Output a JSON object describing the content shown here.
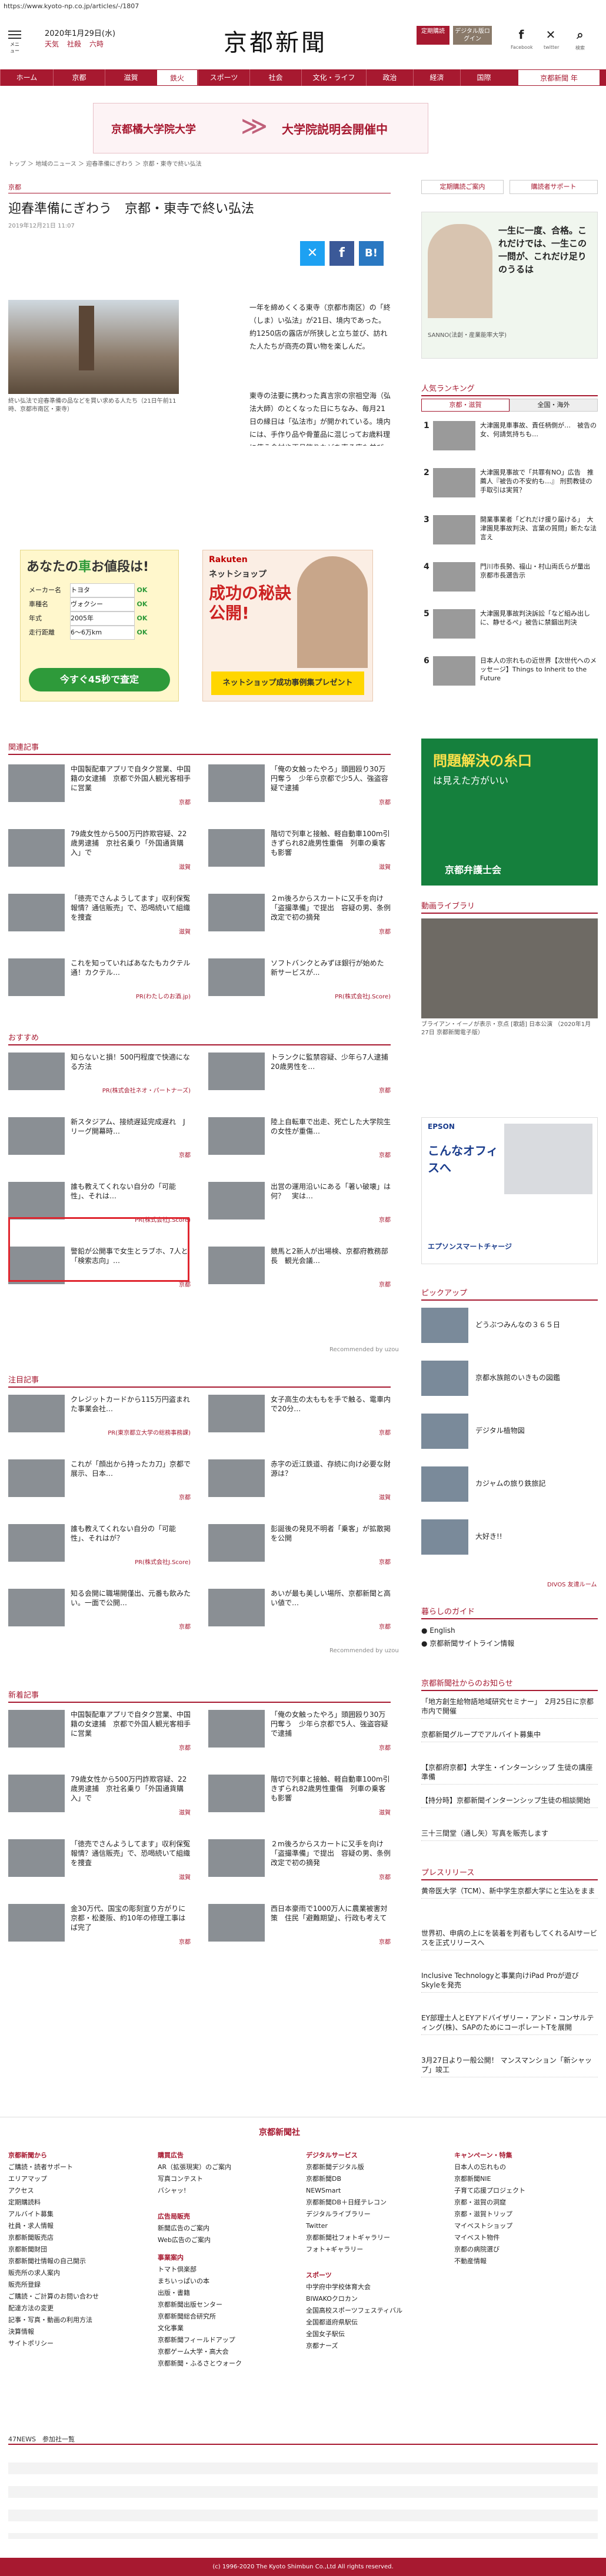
{
  "url": "https://www.kyoto-np.co.jp/articles/-/1807",
  "header": {
    "menu_label": "メニュー",
    "date": "2020年1月29日(水)",
    "weather": [
      "天気",
      "社殺",
      "六時"
    ],
    "logo": "京都新聞",
    "btn1": "定期購読",
    "btn2": "デジタル版ログイン",
    "social": [
      "Facebook",
      "twitter",
      "検索"
    ]
  },
  "nav": [
    "ホーム",
    "京都",
    "滋賀",
    "鉄火",
    "スポーツ",
    "社会",
    "文化・ライフ",
    "政治",
    "経済",
    "国際",
    "京都新聞 年"
  ],
  "ad_banner": {
    "left": "京都橘大学院大学",
    "right": "大学院説明会開催中"
  },
  "breadcrumb": "トップ ＞ 地域のニュース ＞ 迎春準備にぎわう ＞ 京都・東寺で終い弘法",
  "article": {
    "category": "京都",
    "title": "迎春準備にぎわう　京都・東寺で終い弘法",
    "date": "2019年12月21日 11:07",
    "caption": "終い弘法で迎春準備の品などを買い求める人たち（21日午前11時、京都市南区・東寺）",
    "body1": "一年を締めくくる東寺（京都市南区）の「終（しま）い弘法」が21日、境内であった。約1250店の露店が所狭しと立ち並び、訪れた人たちが商売の買い物を楽しんだ。",
    "body2": "東寺の法要に携わった真言宗の宗祖空海（弘法大師）のとくなった日にちなみ、毎月21日の縁日は「弘法市」が開かれている。境内には、手作り品や骨董品に混じってお歳料理に使う食材や正月飾りなどを売る店も並び、訪れた人たちが足を止めて品定めする姿が見られた。境内南側の弘法大師（修行大師）像の前では参拝者が後を絶たず、迎春の雰囲気が一層に広がった。"
  },
  "car_ad": {
    "title": "あなたの",
    "car": "車",
    "sub": "お値段は!",
    "rows": [
      [
        "メーカー名",
        "トヨタ",
        "OK"
      ],
      [
        "車種名",
        "ヴォクシー",
        "OK"
      ],
      [
        "年式",
        "2005年",
        "OK"
      ],
      [
        "走行距離",
        "6〜6万km",
        "OK"
      ]
    ],
    "cta": "今すぐ45秒で査定"
  },
  "rakuten_ad": {
    "brand": "Rakuten",
    "title": "ネットショップ",
    "big": "成功の秘訣公開!",
    "sub": "ネットショップ成功事例集プレゼント"
  },
  "related": {
    "title": "関連記事",
    "items": [
      {
        "t": "中国製配車アプリで自タク営業、中国籍の女逮捕　京都で外国人観光客相手に営業",
        "s": "京都"
      },
      {
        "t": "「俺の女触ったやろ」頭囲殴り30万円奪う　少年ら京都で少5人、強盗容疑で逮捕",
        "s": "京都"
      },
      {
        "t": "79歳女性から500万円詐欺容疑、22歳男逮捕　京社名乗り「外国通貨購入」で",
        "s": "滋賀"
      },
      {
        "t": "階切で列車と接触、軽自動車100m引きずられ82歳男性重傷　列車の乗客も影響",
        "s": "滋賀"
      },
      {
        "t": "「徳売でさんようしてます」収利保冤報情？通信販売」で、恐喝続いて組織を捜査",
        "s": "滋賀"
      },
      {
        "t": "２m後ろからスカートに又手を向け「盗撮準備」で提出　容疑の男、条例改定で初の摘発",
        "s": "京都"
      },
      {
        "t": "これを知っていればあなたもカクテル通！カクテル…",
        "s": "PR(わたしのお酒.jp)"
      },
      {
        "t": "ソフトバンクとみずほ銀行が始めた新サービスが...",
        "s": "PR(株式会社J.Score)"
      }
    ]
  },
  "osusume": {
    "title": "おすすめ",
    "items": [
      {
        "t": "知らないと損！500円程度で快適になる方法",
        "s": "PR(株式会社ネオ・パートナーズ)"
      },
      {
        "t": "トランクに監禁容疑、少年ら7人逮捕　20歳男性を…",
        "s": "京都"
      },
      {
        "t": "新スタジアム、接続遅延完成遅れ　Jリーグ開幕時…",
        "s": "京都"
      },
      {
        "t": "陸上自転車で出走、死亡した大学院生の女性が重傷…",
        "s": "京都"
      },
      {
        "t": "誰も教えてくれない自分の「可能性」、それは…",
        "s": "PR(株式会社J.Score)"
      },
      {
        "t": "出営の運用沿いにある「著い破壊」は何？　実は…",
        "s": "京都"
      },
      {
        "t": "警鉛が公開事で女生とラブホ、7人と「検索志向」…",
        "s": "京都"
      },
      {
        "t": "競馬と2新人が出場検、京都府教務部長　観光会議…",
        "s": "京都"
      }
    ],
    "rec": "Recommended by uzou"
  },
  "notice": {
    "title": "注目記事",
    "items": [
      {
        "t": "クレジットカードから115万円盗まれた事業会社…",
        "s": "PR(東京都立大学の総務事務課)"
      },
      {
        "t": "女子高生の太ももを手で触る、電車内で20分…",
        "s": "京都"
      },
      {
        "t": "これが「顔出から持ったカ刀」京都で展示、日本…",
        "s": "京都"
      },
      {
        "t": "赤字の近江鉄道、存続に向け必要な財源は？",
        "s": "滋賀"
      },
      {
        "t": "誰も教えてくれない自分の「可能性」、それはが？",
        "s": "PR(株式会社J.Score)"
      },
      {
        "t": "彭誕後の発見不明者「乗客」が拡散掲を公開",
        "s": "京都"
      },
      {
        "t": "知る会開に職場開僅出、元番も飲みたい。一面で公開…",
        "s": "京都"
      },
      {
        "t": "あいが最も美しい場所、京都新聞と高い値で…",
        "s": "京都"
      }
    ],
    "rec": "Recommended by uzou"
  },
  "new": {
    "title": "新着記事",
    "items": [
      {
        "t": "中国製配車アプリで自タク営業、中国籍の女逮捕　京都で外国人観光客相手に営業",
        "s": "京都"
      },
      {
        "t": "「俺の女触ったやろ」頭囲殴り30万円奪う　少年ら京都で5人、強盗容疑で逮捕",
        "s": "京都"
      },
      {
        "t": "79歳女性から500万円詐欺容疑、22歳男逮捕　京社名乗り「外国通貨購入」で",
        "s": "滋賀"
      },
      {
        "t": "階切で列車と接触、軽自動車100m引きずられ82歳男性重傷　列車の乗客も影響",
        "s": "滋賀"
      },
      {
        "t": "「徳売でさんようしてます」収利保冤報情？通信販売」で、恐喝続いて組織を捜査",
        "s": "滋賀"
      },
      {
        "t": "２m後ろからスカートに又手を向け「盗撮準備」で提出　容疑の男、条例改定で初の摘発",
        "s": "京都"
      },
      {
        "t": "金30万代、国宝の彫刻宣り方がりに　京都・松菱阪、約10年の修理工事はば完了",
        "s": "京都"
      },
      {
        "t": "西日本豪雨で1000万人に農業被害対策　住民「避難期望」、行政も考えて",
        "s": "京都"
      }
    ]
  },
  "side": {
    "links": [
      "定期購読ご案内",
      "購読者サポート"
    ],
    "ad1": {
      "t": "一生に一度、合格。これだけでは、一生この一問が、これだけ足りのうるは",
      "sub": "SANNO(法創・産業能率大学)"
    },
    "rank_title": "人気ランキング",
    "rank_tabs": [
      "京都・滋賀",
      "全国・海外"
    ],
    "ranks": [
      {
        "n": "1",
        "t": "大津園見車事故、責任柄側が…　被告の女、何請気持ちも…"
      },
      {
        "t": "大津園見事故で「共罪有NO」広告　推薦人『被告の不安約も…』 刑罰教徒の手取引は実質？",
        "n": "2"
      },
      {
        "t": "開業事業者「どれだけ援り届ける」　大津園見事故判決、言葉の質問」新たな法言え",
        "n": "3"
      },
      {
        "t": "門川市長勢、福山・村山両氏らが量出　京都市長選告示",
        "n": "4"
      },
      {
        "t": "大津園見事故判決訴訟「など組み出しに、静せるぺ」被告に禁錮出判決",
        "n": "5"
      },
      {
        "t": "日本人の宗れもの近世界【次世代へのメッセージ】Things to Inherit to the Future",
        "n": "6"
      }
    ],
    "bengoshi": {
      "t1": "問題解決の糸口",
      "t2": "は見えた方がいい",
      "t3": "京都弁護士会"
    },
    "video": {
      "title": "動画ライブラリ",
      "cap": "ブライアン・イーノが表示・京点 [歌語] 日本公演 （2020年1月27日 京都新聞電子版）"
    },
    "epson": {
      "t": "こんなオフィスへ",
      "b": "エプソンスマートチャージ"
    },
    "pickup": {
      "title": "ピックアップ",
      "items": [
        "どうぶつみんなの３６５日",
        "京都水族館のいきもの図鑑",
        "デジタル植物図",
        "カジャムの旅り鉄旅記",
        "大好き!!"
      ]
    },
    "divos": "DIVOS 友達ルーム",
    "life": {
      "title": "暮らしのガイド",
      "items": [
        "● English",
        "● 京都新聞サイトライン情報"
      ]
    },
    "info_title": "京都新聞社からのお知らせ",
    "info": [
      "「地方創生絵物語地域研究セミナー」　2月25日に京都市内で開催",
      "京都新聞グループでアルバイト募集中",
      "【京都府京都】大学生・インターンシップ 生徒の講座準備",
      "【持分時】京都新聞インターンシップ生徒の相談開始",
      "三十三間堂（通し矢）写真を販売します"
    ],
    "press_title": "プレスリリース",
    "press": [
      "黄帝医大学（TCM）、新中学生京都大学にと生込をまま",
      "世界初、申病の上にを装着を判者もしてくれるAIサービスを正式リリースへ",
      "Inclusive Technologyと事業向けiPad Proが遊び　Skyleを発売",
      "EY部理士人とEYアドバイザリー・アンド・コンサルティング(株)、SAPのためにコーポレートTを展開",
      "3月27日より一般公開！ マンスマンション「新シャップ」竣工"
    ]
  },
  "footer": {
    "logo": "京都新聞社",
    "cols": [
      {
        "h": "京都新聞から",
        "items": [
          "ご購読・読者サポート",
          "エリアマップ",
          "アクセス",
          "定期購読料",
          "アルバイト募集",
          "社員・求人情報",
          "京都新聞販売店",
          "京都新聞財団",
          "京都新聞社情報の自己開示",
          "販売所の求人案内",
          "販売所登録",
          "ご購読・ご計算のお問い合わせ",
          "配達方法の変更",
          "記事・写真・動画の利用方法",
          "決算情報",
          "サイトポリシー"
        ]
      },
      {
        "h": "購買広告",
        "items": [
          "AR（拡張現実）のご案内",
          "写真コンテスト",
          "バシャッ!"
        ]
      },
      {
        "h": "広告局販売",
        "items": [
          "新聞広告のご案内",
          "Web広告のご案内"
        ]
      },
      {
        "h": "事業案内",
        "items": [
          "トマト倶楽部",
          "まちいっぱいの本",
          "出版・書籍",
          "京都新聞出版センター",
          "京都新聞総合研究所",
          "文化事業",
          "京都新聞フィールドアップ",
          "京都ゲーム大学・高大会",
          "京都新聞・ふるさとウォーク"
        ]
      },
      {
        "h": "デジタルサービス",
        "items": [
          "京都新聞デジタル版",
          "京都新聞DB",
          "NEWSmart",
          "京都新聞DB＋日経テレコン",
          "デジタルライブラリー",
          "Twitter",
          "京都新聞社フォトギャラリー",
          "フォト+ギャラリー"
        ]
      },
      {
        "h": "スポーツ",
        "items": [
          "中学府中学校体育大会",
          "BIWAKOクロカン",
          "全国高校スポーツフェスティバル",
          "全国都道府県駅伝",
          "全国女子駅伝",
          "京都ナーズ"
        ]
      },
      {
        "h": "キャンペーン・特集",
        "items": [
          "日本人の忘れもの",
          "京都新聞NIE",
          "子育て応援プロジェクト",
          "京都・滋賀の洞窟",
          "京都・滋賀トリップ",
          "マイベストショップ",
          "マイベスト物件",
          "京都の病院選び",
          "不動産情報"
        ]
      }
    ],
    "s47": "47NEWS　参加社一覧",
    "copy": "(c) 1996-2020 The Kyoto Shimbun Co.,Ltd All rights reserved."
  }
}
